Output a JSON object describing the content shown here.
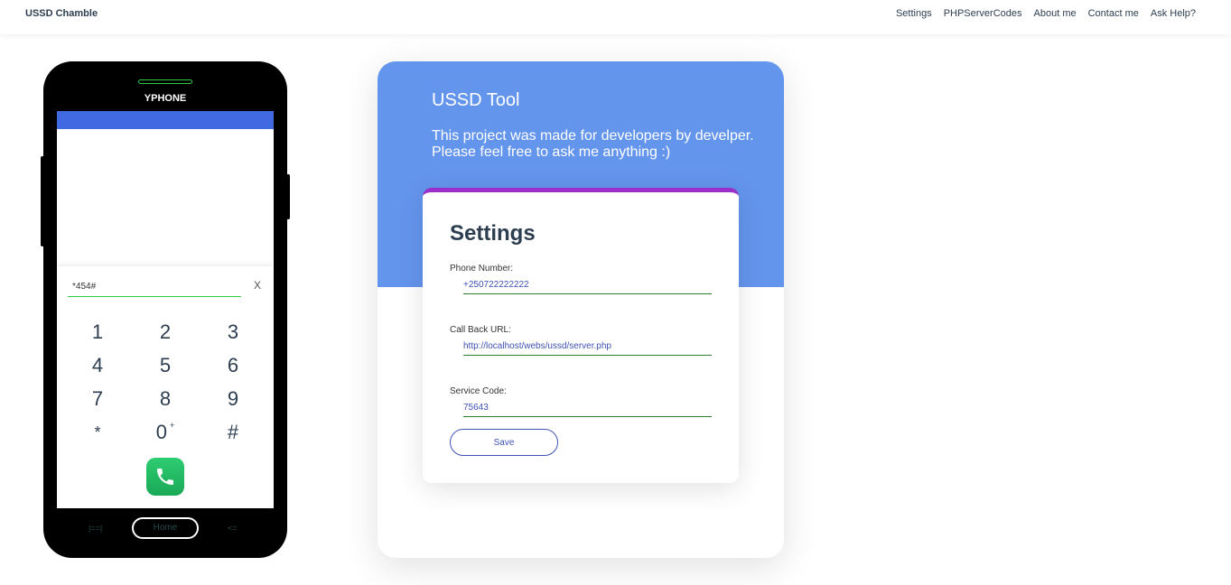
{
  "navbar": {
    "brand": "USSD Chamble",
    "links": [
      "Settings",
      "PHPServerCodes",
      "About me",
      "Contact me",
      "Ask Help?"
    ]
  },
  "phone": {
    "brand": "YPHONE",
    "dial_value": "*454#",
    "clear_label": "X",
    "keys": [
      "1",
      "2",
      "3",
      "4",
      "5",
      "6",
      "7",
      "8",
      "9",
      "*",
      "0",
      "#"
    ],
    "zero_sup": "+",
    "nav_left": "|==|",
    "home_label": "Home",
    "nav_right": "<=",
    "accent_color": "#4169e1"
  },
  "card": {
    "title": "USSD Tool",
    "description": "This project was made for developers by develper. Please feel free to ask me anything :)",
    "header_color": "#6495ed"
  },
  "settings": {
    "title": "Settings",
    "fields": [
      {
        "label": "Phone Number:",
        "value": "+250722222222"
      },
      {
        "label": "Call Back URL:",
        "value": "http://localhost/webs/ussd/server.php"
      },
      {
        "label": "Service Code:",
        "value": "75643"
      }
    ],
    "save_label": "Save",
    "accent_color": "#9b2fc9"
  }
}
